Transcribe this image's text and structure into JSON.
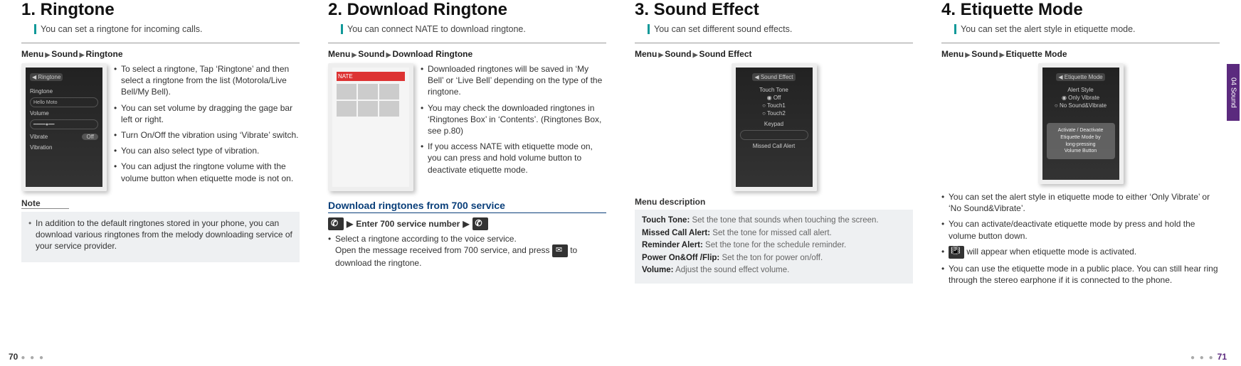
{
  "sideTab": "04 Sound",
  "pageLeft": "70",
  "pageRight": "71",
  "sec1": {
    "title": "1. Ringtone",
    "subtitle": "You can set a ringtone for incoming calls.",
    "bc1": "Menu",
    "bc2": "Sound",
    "bc3": "Ringtone",
    "b1": "To select a ringtone, Tap ‘Ringtone’ and then select a ringtone from the list (Motorola/Live Bell/My Bell).",
    "b2": "You can set volume by dragging the gage bar left or right.",
    "b3": "Turn On/Off the vibration using ‘Vibrate’ switch.",
    "b4": "You can also select type of vibration.",
    "b5": "You can adjust the ringtone volume with the volume button when etiquette mode is not on.",
    "noteH": "Note",
    "note1": "In addition to the default ringtones stored in your phone, you can download various ringtones from the melody downloading service of your service provider."
  },
  "sec2": {
    "title": "2. Download Ringtone",
    "subtitle": "You can connect NATE to download ringtone.",
    "bc1": "Menu",
    "bc2": "Sound",
    "bc3": "Download Ringtone",
    "b1": "Downloaded ringtones will be saved in ‘My Bell’ or ‘Live Bell’ depending on the type of the ringtone.",
    "b2": "You may check the downloaded ringtones in ‘Ringtones Box’ in ‘Contents’. (Ringtones Box, see p.80)",
    "b3": "If you access NATE with etiquette mode on, you can press and hold volume button to deactivate etiquette mode.",
    "subH": "Download ringtones from 700 service",
    "dial": "Enter 700 service number",
    "p1a": "Select a ringtone according to the voice service.",
    "p1b": "Open the message received from 700 service, and press",
    "p1c": "to download the ringtone."
  },
  "sec3": {
    "title": "3. Sound Effect",
    "subtitle": "You can set different sound effects.",
    "bc1": "Menu",
    "bc2": "Sound",
    "bc3": "Sound Effect",
    "menuDescH": "Menu description",
    "d1l": "Touch Tone:",
    "d1t": " Set the tone that sounds when touching the screen.",
    "d2l": "Missed Call Alert:",
    "d2t": " Set the tone for missed call alert.",
    "d3l": "Reminder Alert:",
    "d3t": " Set the tone for the schedule reminder.",
    "d4l": "Power On&Off /Flip:",
    "d4t": " Set the ton for power on/off.",
    "d5l": "Volume:",
    "d5t": " Adjust the sound effect volume."
  },
  "sec4": {
    "title": "4. Etiquette Mode",
    "subtitle": "You can set the alert style in etiquette mode.",
    "bc1": "Menu",
    "bc2": "Sound",
    "bc3": "Etiquette Mode",
    "b1": "You can set the alert style in etiquette mode to either ‘Only Vibrate’ or ‘No Sound&Vibrate’.",
    "b2": "You can activate/deactivate etiquette mode by press and hold the volume button down.",
    "b3pre": " will appear when etiquette mode is activated.",
    "b4": "You can use the etiquette mode in a public place. You can still hear ring through the stereo earphone if it is connected to the phone."
  }
}
